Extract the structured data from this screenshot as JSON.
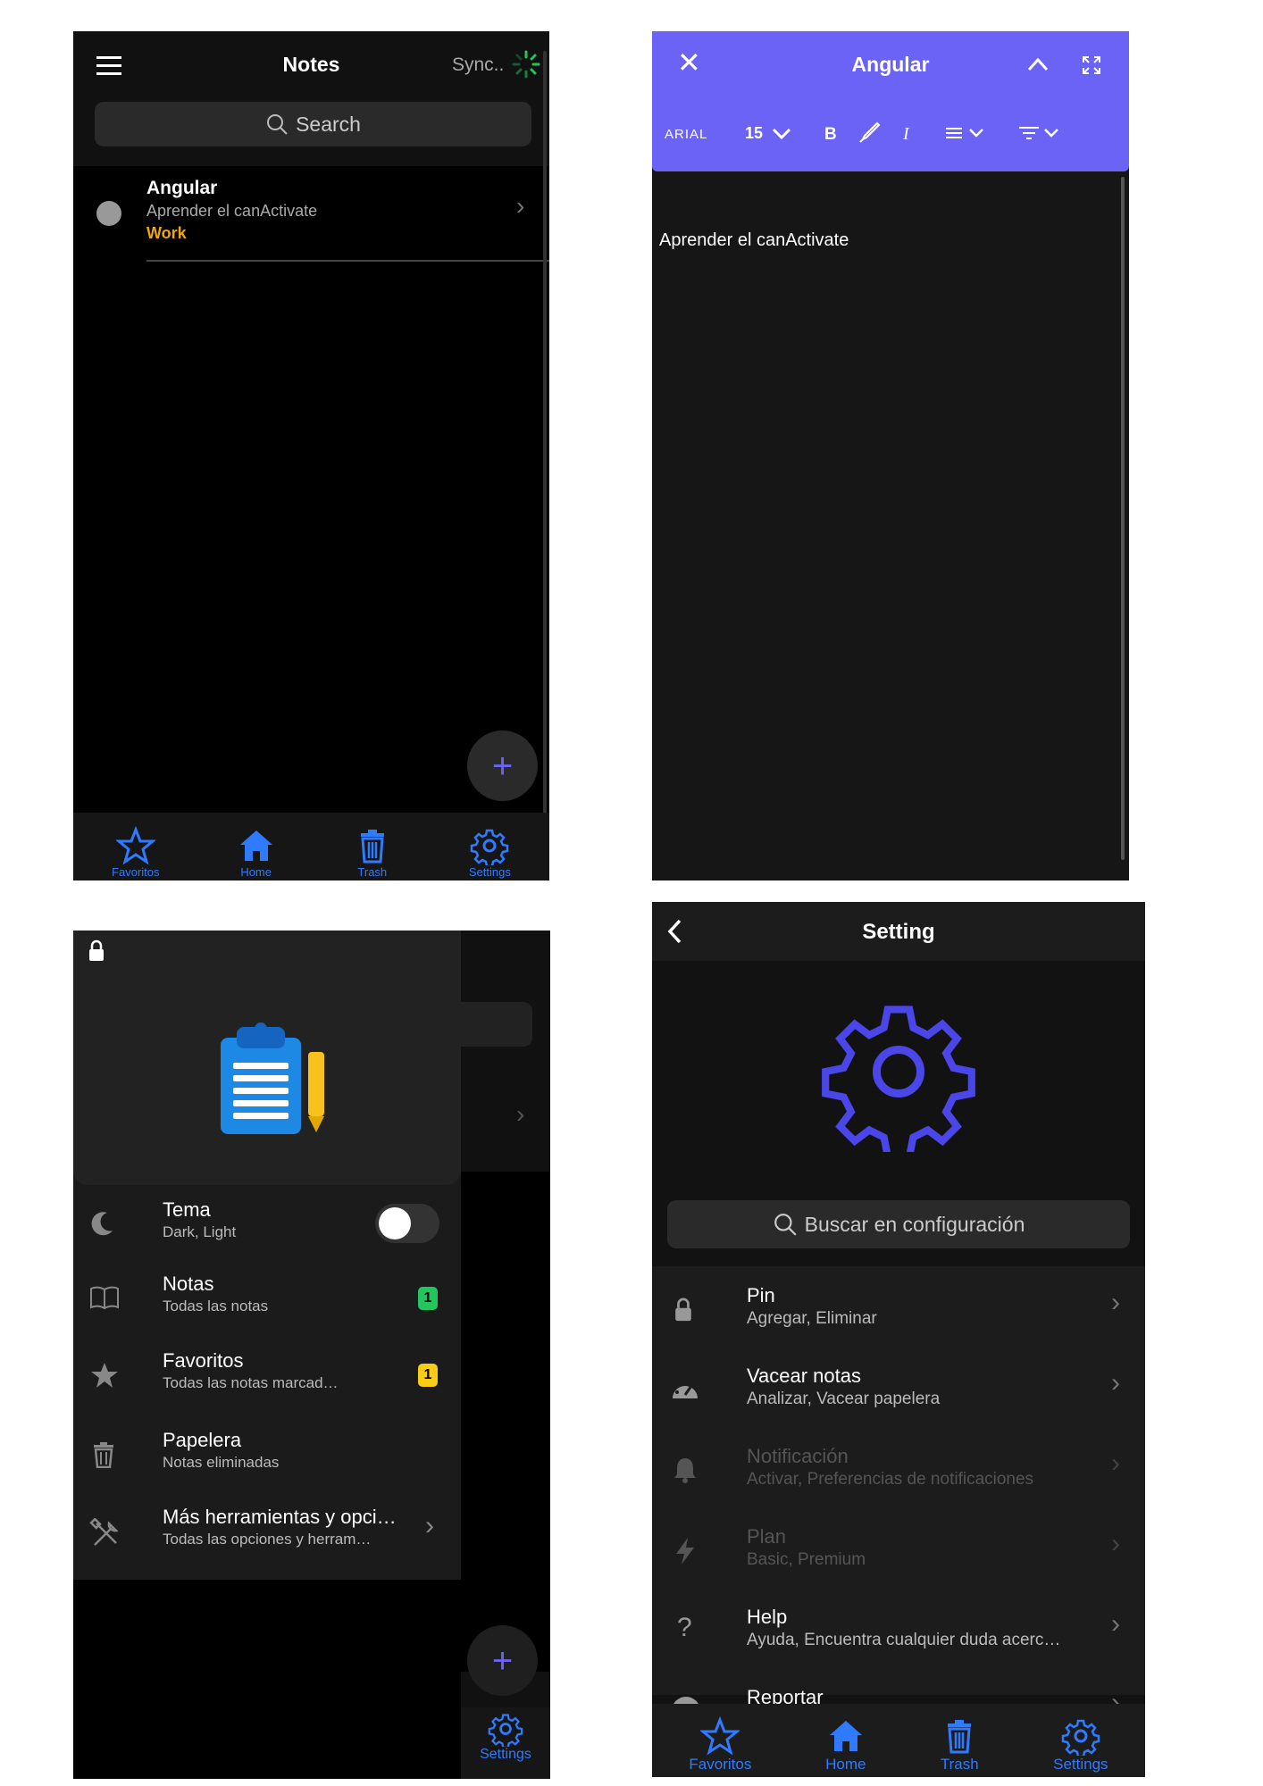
{
  "notes_screen": {
    "title": "Notes",
    "sync_text": "Sync..",
    "search_placeholder": "Search",
    "note": {
      "title": "Angular",
      "preview": "Aprender el canActivate",
      "tag": "Work"
    },
    "fab_label": "+",
    "nav": [
      "Favoritos",
      "Home",
      "Trash",
      "Settings"
    ]
  },
  "editor_screen": {
    "title": "Angular",
    "font_name": "ARIAL",
    "font_size": "15",
    "bold_label": "B",
    "italic_label": "I",
    "body_text": "Aprender el canActivate"
  },
  "drawer_screen": {
    "items": [
      {
        "title": "Tema",
        "subtitle": "Dark, Light"
      },
      {
        "title": "Notas",
        "subtitle": "Todas las notas",
        "badge": "1"
      },
      {
        "title": "Favoritos",
        "subtitle": "Todas las notas marcad…",
        "badge": "1"
      },
      {
        "title": "Papelera",
        "subtitle": "Notas eliminadas"
      },
      {
        "title": "Más herramientas y opci…",
        "subtitle": "Todas las opciones y herram…"
      }
    ],
    "fab_label": "+",
    "settings_label": "Settings"
  },
  "settings_screen": {
    "title": "Setting",
    "search_placeholder": "Buscar en configuración",
    "items": [
      {
        "title": "Pin",
        "subtitle": "Agregar, Eliminar"
      },
      {
        "title": "Vacear notas",
        "subtitle": "Analizar, Vacear papelera"
      },
      {
        "title": "Notificación",
        "subtitle": "Activar, Preferencias de notificaciones"
      },
      {
        "title": "Plan",
        "subtitle": "Basic, Premium"
      },
      {
        "title": "Help",
        "subtitle": "Ayuda, Encuentra cualquier duda acerc…"
      },
      {
        "title": "Reportar",
        "subtitle": ""
      }
    ],
    "help_icon_text": "?",
    "nav": [
      "Favoritos",
      "Home",
      "Trash",
      "Settings"
    ]
  },
  "colors": {
    "accent": "#2f7bff",
    "editor_header": "#6a63f6",
    "tag": "#f0a800",
    "badge_green": "#22c55e",
    "badge_yellow": "#facc15",
    "gear": "#4a46e8"
  }
}
